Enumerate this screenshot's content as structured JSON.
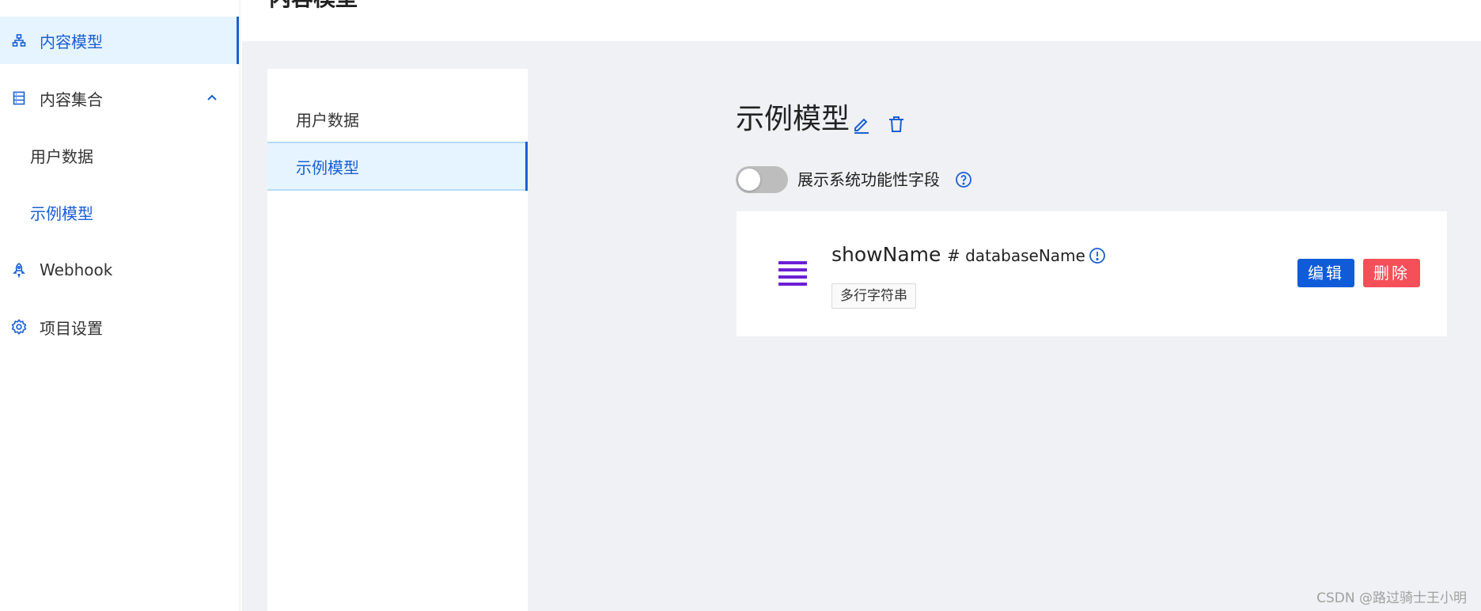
{
  "header": {
    "title": "内容模型"
  },
  "sidebar": {
    "items": [
      {
        "label": "内容模型",
        "icon": "sitemap-icon",
        "active": true
      },
      {
        "label": "内容集合",
        "icon": "database-icon",
        "expanded": true
      },
      {
        "label": "用户数据",
        "sub": true
      },
      {
        "label": "示例模型",
        "sub": true,
        "current": true
      },
      {
        "label": "Webhook",
        "icon": "webhook-icon"
      },
      {
        "label": "项目设置",
        "icon": "gear-icon"
      }
    ]
  },
  "model_list": {
    "items": [
      {
        "label": "用户数据"
      },
      {
        "label": "示例模型",
        "active": true
      }
    ]
  },
  "detail": {
    "title": "示例模型",
    "toggle_label": "展示系统功能性字段",
    "toggle_on": false
  },
  "field": {
    "name": "showName",
    "db_name": "# databaseName",
    "type": "多行字符串",
    "edit_label": "编辑",
    "delete_label": "删除"
  },
  "watermark": "CSDN @路过骑士王小明",
  "colors": {
    "accent": "#1a5fd6",
    "active_bg": "#e6f4ff",
    "main_bg": "#f0f1f4",
    "edit_btn": "#0f5bd8",
    "delete_btn": "#f5505a",
    "drag_icon": "#6b1fd3"
  }
}
